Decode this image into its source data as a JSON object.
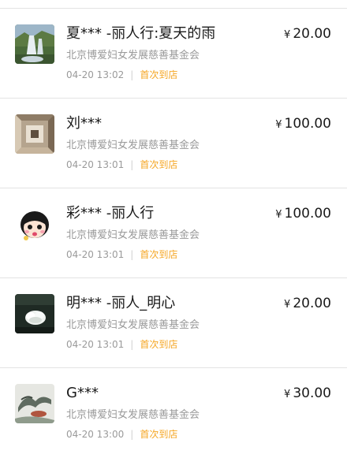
{
  "currency_symbol": "¥",
  "accent_color": "#f5a623",
  "donations": [
    {
      "avatar": "waterfall-photo",
      "name": "夏*** -丽人行:夏天的雨",
      "amount": "20.00",
      "org": "北京博爱妇女发展慈善基金会",
      "time": "04-20 13:02",
      "tag": "首次到店"
    },
    {
      "avatar": "abstract-tunnel-photo",
      "name": "刘***",
      "amount": "100.00",
      "org": "北京博爱妇女发展慈善基金会",
      "time": "04-20 13:01",
      "tag": "首次到店"
    },
    {
      "avatar": "cartoon-girl-avatar",
      "name": "彩*** -丽人行",
      "amount": "100.00",
      "org": "北京博爱妇女发展慈善基金会",
      "time": "04-20 13:01",
      "tag": "首次到店"
    },
    {
      "avatar": "white-flower-photo",
      "name": "明*** -丽人_明心",
      "amount": "20.00",
      "org": "北京博爱妇女发展慈善基金会",
      "time": "04-20 13:01",
      "tag": "首次到店"
    },
    {
      "avatar": "ink-painting-photo",
      "name": "G***",
      "amount": "30.00",
      "org": "北京博爱妇女发展慈善基金会",
      "time": "04-20 13:00",
      "tag": "首次到店"
    }
  ]
}
